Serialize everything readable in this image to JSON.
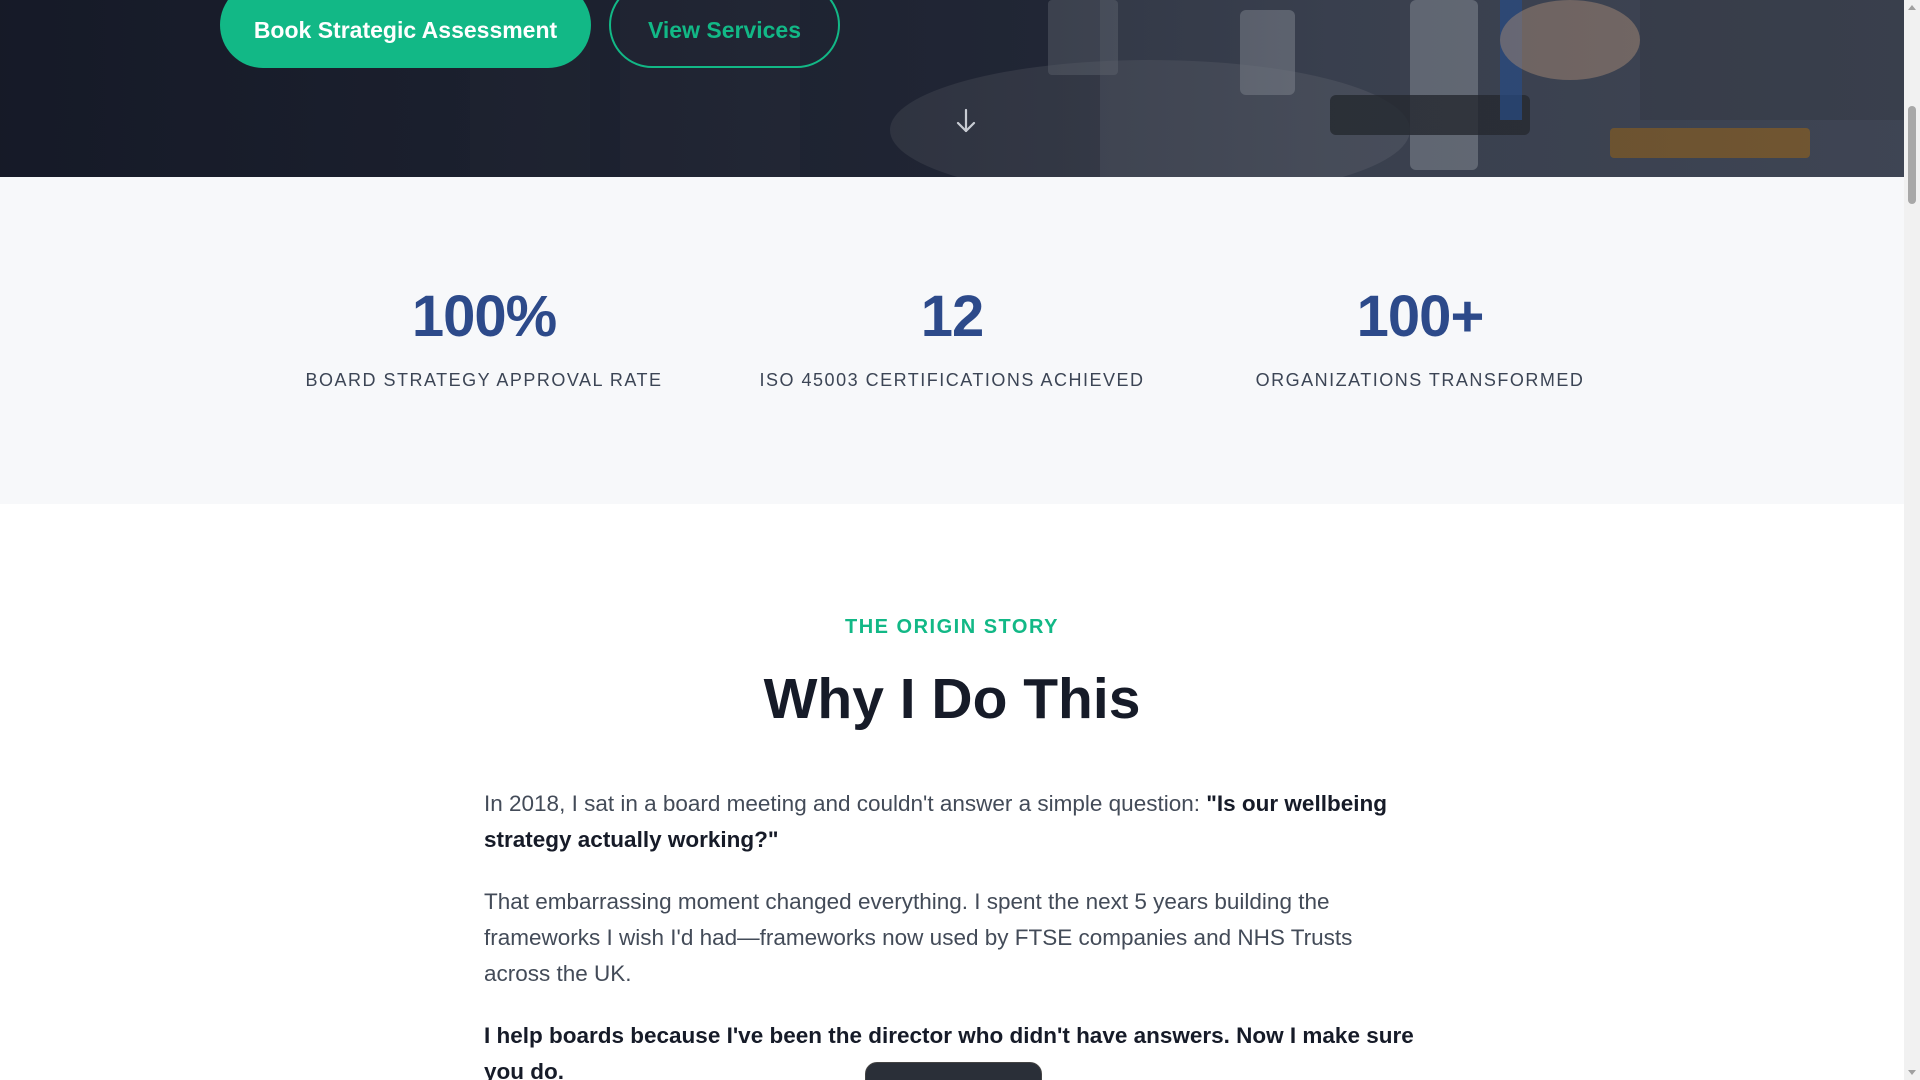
{
  "hero": {
    "primary_button": "Book Strategic Assessment",
    "secondary_button": "View Services",
    "scroll_icon": "arrow-down-icon",
    "colors": {
      "accent": "#12b886"
    }
  },
  "stats": [
    {
      "value": "100%",
      "label": "BOARD STRATEGY APPROVAL RATE"
    },
    {
      "value": "12",
      "label": "ISO 45003 CERTIFICATIONS ACHIEVED"
    },
    {
      "value": "100+",
      "label": "ORGANIZATIONS TRANSFORMED"
    }
  ],
  "origin": {
    "eyebrow": "THE ORIGIN STORY",
    "title": "Why I Do This",
    "p1_lead": "In 2018, I sat in a board meeting and couldn't answer a simple question: ",
    "p1_quote": "\"Is our wellbeing strategy actually working?\"",
    "p2": "That embarrassing moment changed everything. I spent the next 5 years building the frameworks I wish I'd had—frameworks now used by FTSE companies and NHS Trusts across the UK.",
    "p3": "I help boards because I've been the director who didn't have answers. Now I make sure you do."
  },
  "colors": {
    "stat_value": "#2d4a8a",
    "heading": "#161b28"
  }
}
